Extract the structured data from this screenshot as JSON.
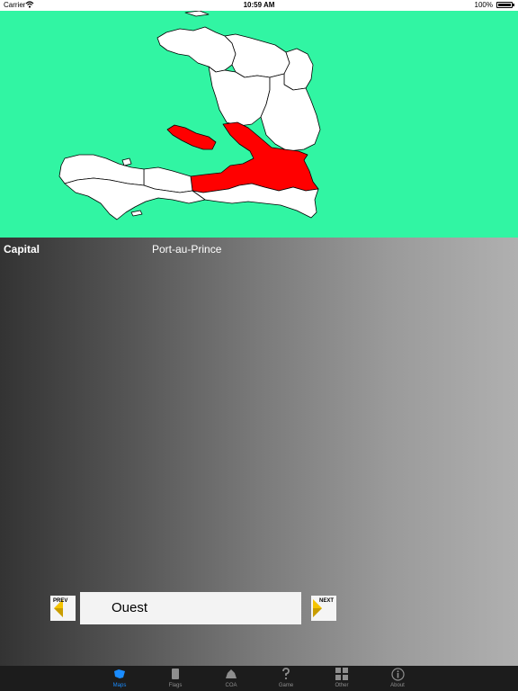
{
  "status_bar": {
    "carrier": "Carrier",
    "time": "10:59 AM",
    "battery": "100%"
  },
  "map": {
    "background_color": "#31f5a3",
    "highlight_color": "#ff0000",
    "region_fill": "#ffffff"
  },
  "info": {
    "capital_label": "Capital",
    "capital_value": "Port-au-Prince"
  },
  "navigator": {
    "prev_label": "PREV",
    "next_label": "NEXT",
    "region_name": "Ouest"
  },
  "tabs": [
    {
      "label": "Maps",
      "icon": "map-icon",
      "active": true
    },
    {
      "label": "Flags",
      "icon": "flag-icon",
      "active": false
    },
    {
      "label": "COA",
      "icon": "coat-of-arms-icon",
      "active": false
    },
    {
      "label": "Game",
      "icon": "question-icon",
      "active": false
    },
    {
      "label": "Other",
      "icon": "grid-icon",
      "active": false
    },
    {
      "label": "About",
      "icon": "info-icon",
      "active": false
    }
  ]
}
